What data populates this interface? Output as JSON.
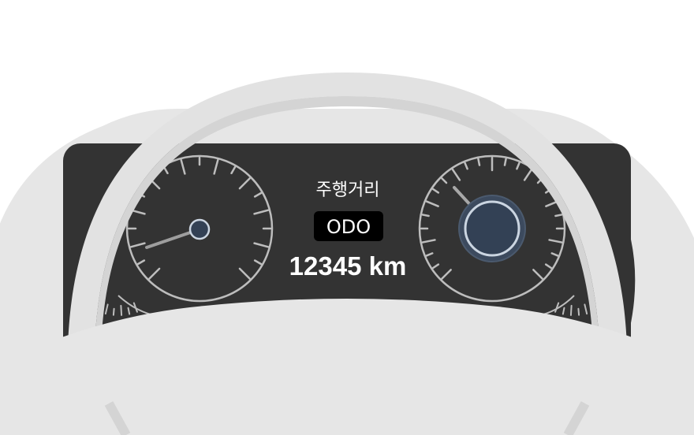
{
  "odometer": {
    "caption": "주행거리",
    "badge": "ODO",
    "distance": "12345 km"
  },
  "colors": {
    "background": "#ffffff",
    "shell": "#e6e6e6",
    "wheel_rim": "#e2e2e2",
    "wheel_inner_rim": "#d4d4d4",
    "cluster": "#333333",
    "gauge_line": "#bdbdbd",
    "hub": "#334155",
    "hub_ring": "#cbd5e1",
    "badge_bg": "#000000",
    "text": "#ffffff"
  }
}
